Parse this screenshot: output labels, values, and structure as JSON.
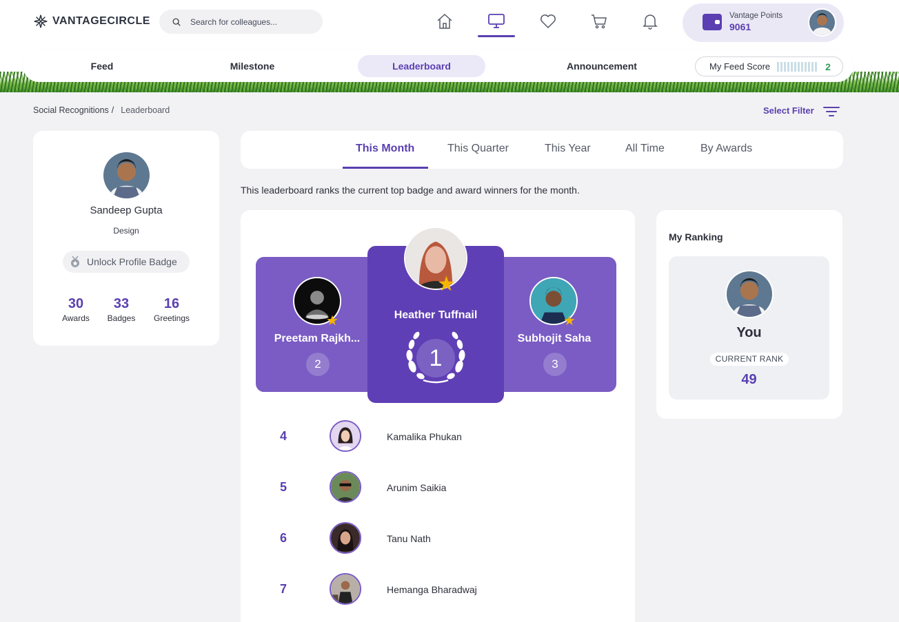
{
  "brand": {
    "name": "VANTAGECIRCLE"
  },
  "search": {
    "placeholder": "Search for colleagues..."
  },
  "nav_icons": [
    "home-icon",
    "desktop-icon",
    "heart-icon",
    "cart-icon",
    "bell-icon"
  ],
  "points": {
    "label": "Vantage Points",
    "value": "9061"
  },
  "tabs": [
    {
      "label": "Feed"
    },
    {
      "label": "Milestone"
    },
    {
      "label": "Leaderboard"
    },
    {
      "label": "Announcement"
    }
  ],
  "feed_score": {
    "label": "My Feed Score",
    "value": "2"
  },
  "breadcrumb": {
    "root": "Social Recognitions",
    "separator": "/",
    "current": "Leaderboard"
  },
  "filter": {
    "label": "Select Filter"
  },
  "profile": {
    "name": "Sandeep Gupta",
    "department": "Design",
    "unlock_label": "Unlock Profile Badge",
    "stats": [
      {
        "value": "30",
        "label": "Awards"
      },
      {
        "value": "33",
        "label": "Badges"
      },
      {
        "value": "16",
        "label": "Greetings"
      }
    ]
  },
  "periods": [
    "This Month",
    "This Quarter",
    "This Year",
    "All Time",
    "By Awards"
  ],
  "description": "This leaderboard ranks the current top badge and award winners for the month.",
  "podium": {
    "first": {
      "name": "Heather Tuffnail",
      "rank": "1"
    },
    "second": {
      "name": "Preetam Rajkh...",
      "rank": "2"
    },
    "third": {
      "name": "Subhojit Saha",
      "rank": "3"
    }
  },
  "rows": [
    {
      "rank": "4",
      "name": "Kamalika Phukan"
    },
    {
      "rank": "5",
      "name": "Arunim Saikia"
    },
    {
      "rank": "6",
      "name": "Tanu Nath"
    },
    {
      "rank": "7",
      "name": "Hemanga Bharadwaj"
    }
  ],
  "my_ranking": {
    "title": "My Ranking",
    "you": "You",
    "current_rank_label": "CURRENT RANK",
    "current_rank": "49"
  },
  "colors": {
    "accent": "#5a3fb0",
    "podium_side": "#7a5cc4",
    "podium_center": "#5f3fb5",
    "star": "#f5b400",
    "score": "#2b9a5a"
  }
}
